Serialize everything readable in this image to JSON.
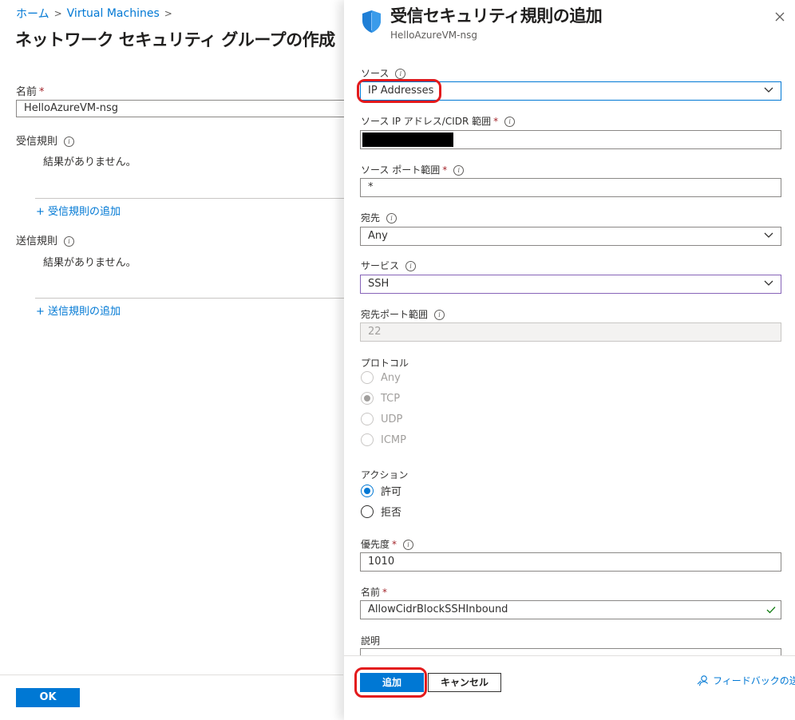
{
  "breadcrumb": {
    "home": "ホーム",
    "sep": ">",
    "vm": "Virtual Machines"
  },
  "left": {
    "title": "ネットワーク セキュリティ グループの作成",
    "name_label": "名前",
    "name_value": "HelloAzureVM-nsg",
    "inbound_label": "受信規則",
    "inbound_empty": "結果がありません。",
    "inbound_add": "+ 受信規則の追加",
    "outbound_label": "送信規則",
    "outbound_empty": "結果がありません。",
    "outbound_add": "+ 送信規則の追加",
    "ok_label": "OK"
  },
  "panel": {
    "title": "受信セキュリティ規則の追加",
    "subtitle": "HelloAzureVM-nsg",
    "source_label": "ソース",
    "source_value": "IP Addresses",
    "source_ip_label": "ソース IP アドレス/CIDR 範囲",
    "source_port_label": "ソース ポート範囲",
    "source_port_value": "*",
    "dest_label": "宛先",
    "dest_value": "Any",
    "service_label": "サービス",
    "service_value": "SSH",
    "dest_port_label": "宛先ポート範囲",
    "dest_port_value": "22",
    "protocol_label": "プロトコル",
    "protocols": [
      "Any",
      "TCP",
      "UDP",
      "ICMP"
    ],
    "action_label": "アクション",
    "actions": [
      "許可",
      "拒否"
    ],
    "priority_label": "優先度",
    "priority_value": "1010",
    "name_label": "名前",
    "name_value": "AllowCidrBlockSSHInbound",
    "desc_label": "説明",
    "add_label": "追加",
    "cancel_label": "キャンセル",
    "feedback_label": "フィードバックの送信"
  },
  "required_mark": "*",
  "info_glyph": "i",
  "colors": {
    "accent": "#0078d4",
    "highlight": "#e31a1c",
    "required": "#a4262c",
    "valid": "#107c10"
  }
}
